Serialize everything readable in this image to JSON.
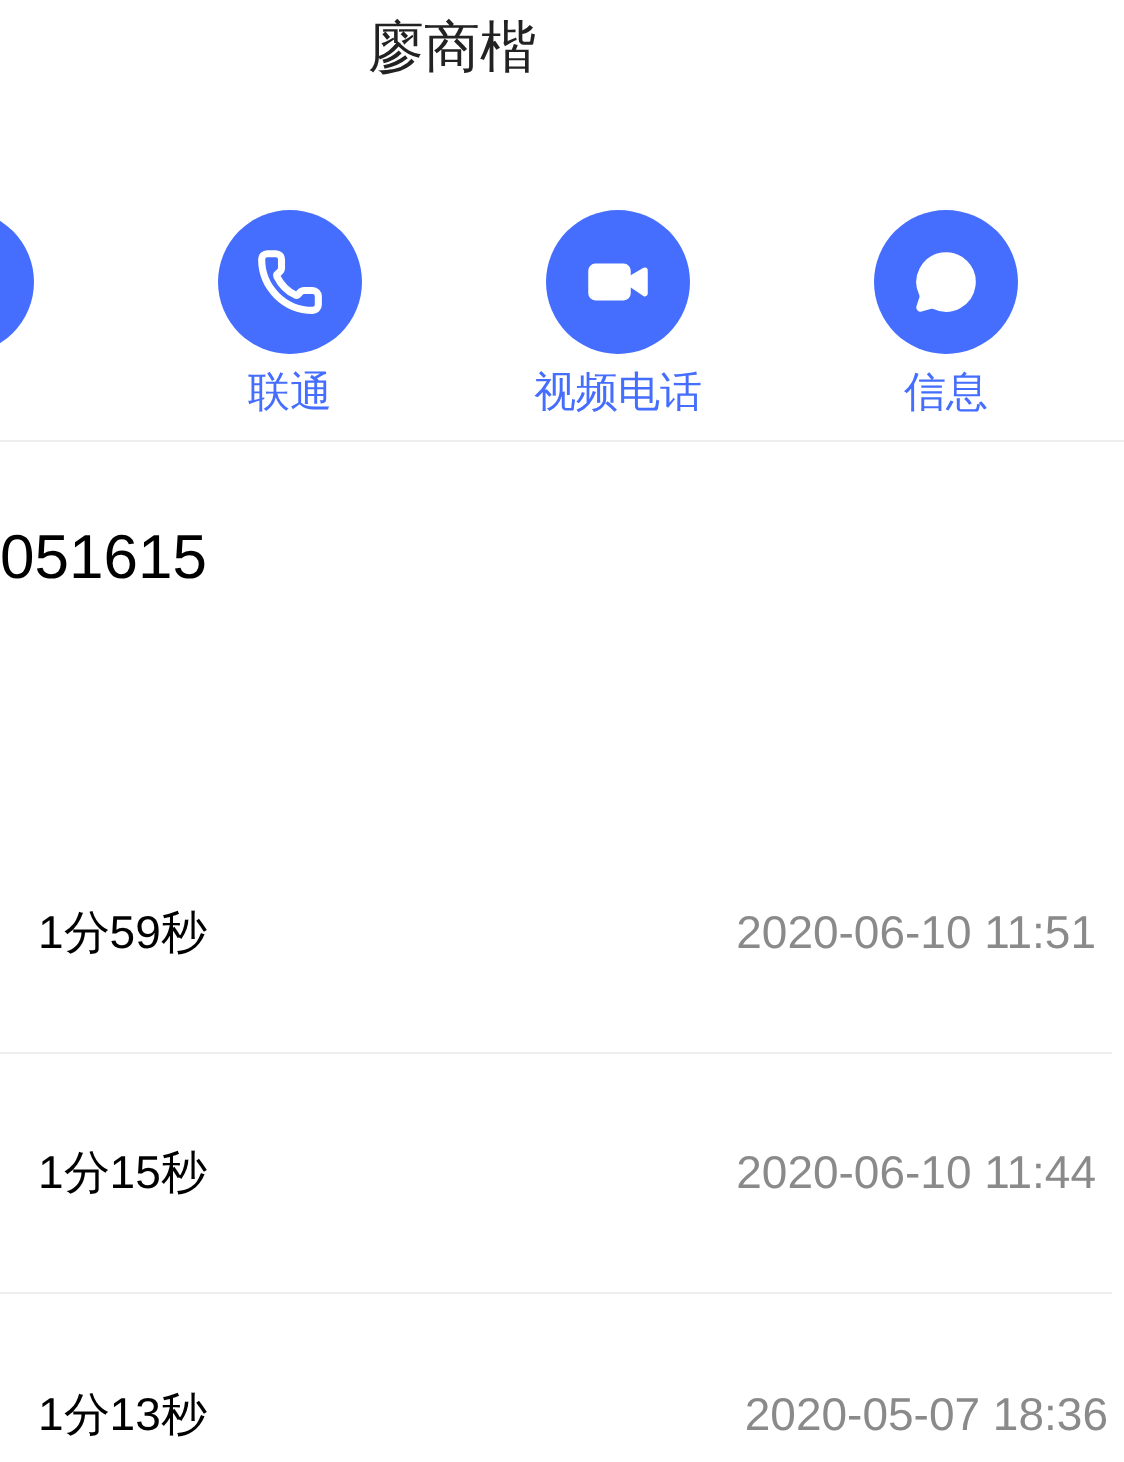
{
  "contact": {
    "name": "廖商楷"
  },
  "actions": [
    {
      "kind": "partial"
    },
    {
      "kind": "call",
      "label": "联通"
    },
    {
      "kind": "video",
      "label": "视频电话"
    },
    {
      "kind": "message",
      "label": "信息"
    }
  ],
  "phone_number": "051615",
  "call_log": [
    {
      "detail": "1分59秒",
      "time": "2020-06-10 11:51"
    },
    {
      "detail": "1分15秒",
      "time": "2020-06-10 11:44"
    },
    {
      "detail": "1分13秒",
      "time": "2020-05-07 18:36"
    }
  ]
}
